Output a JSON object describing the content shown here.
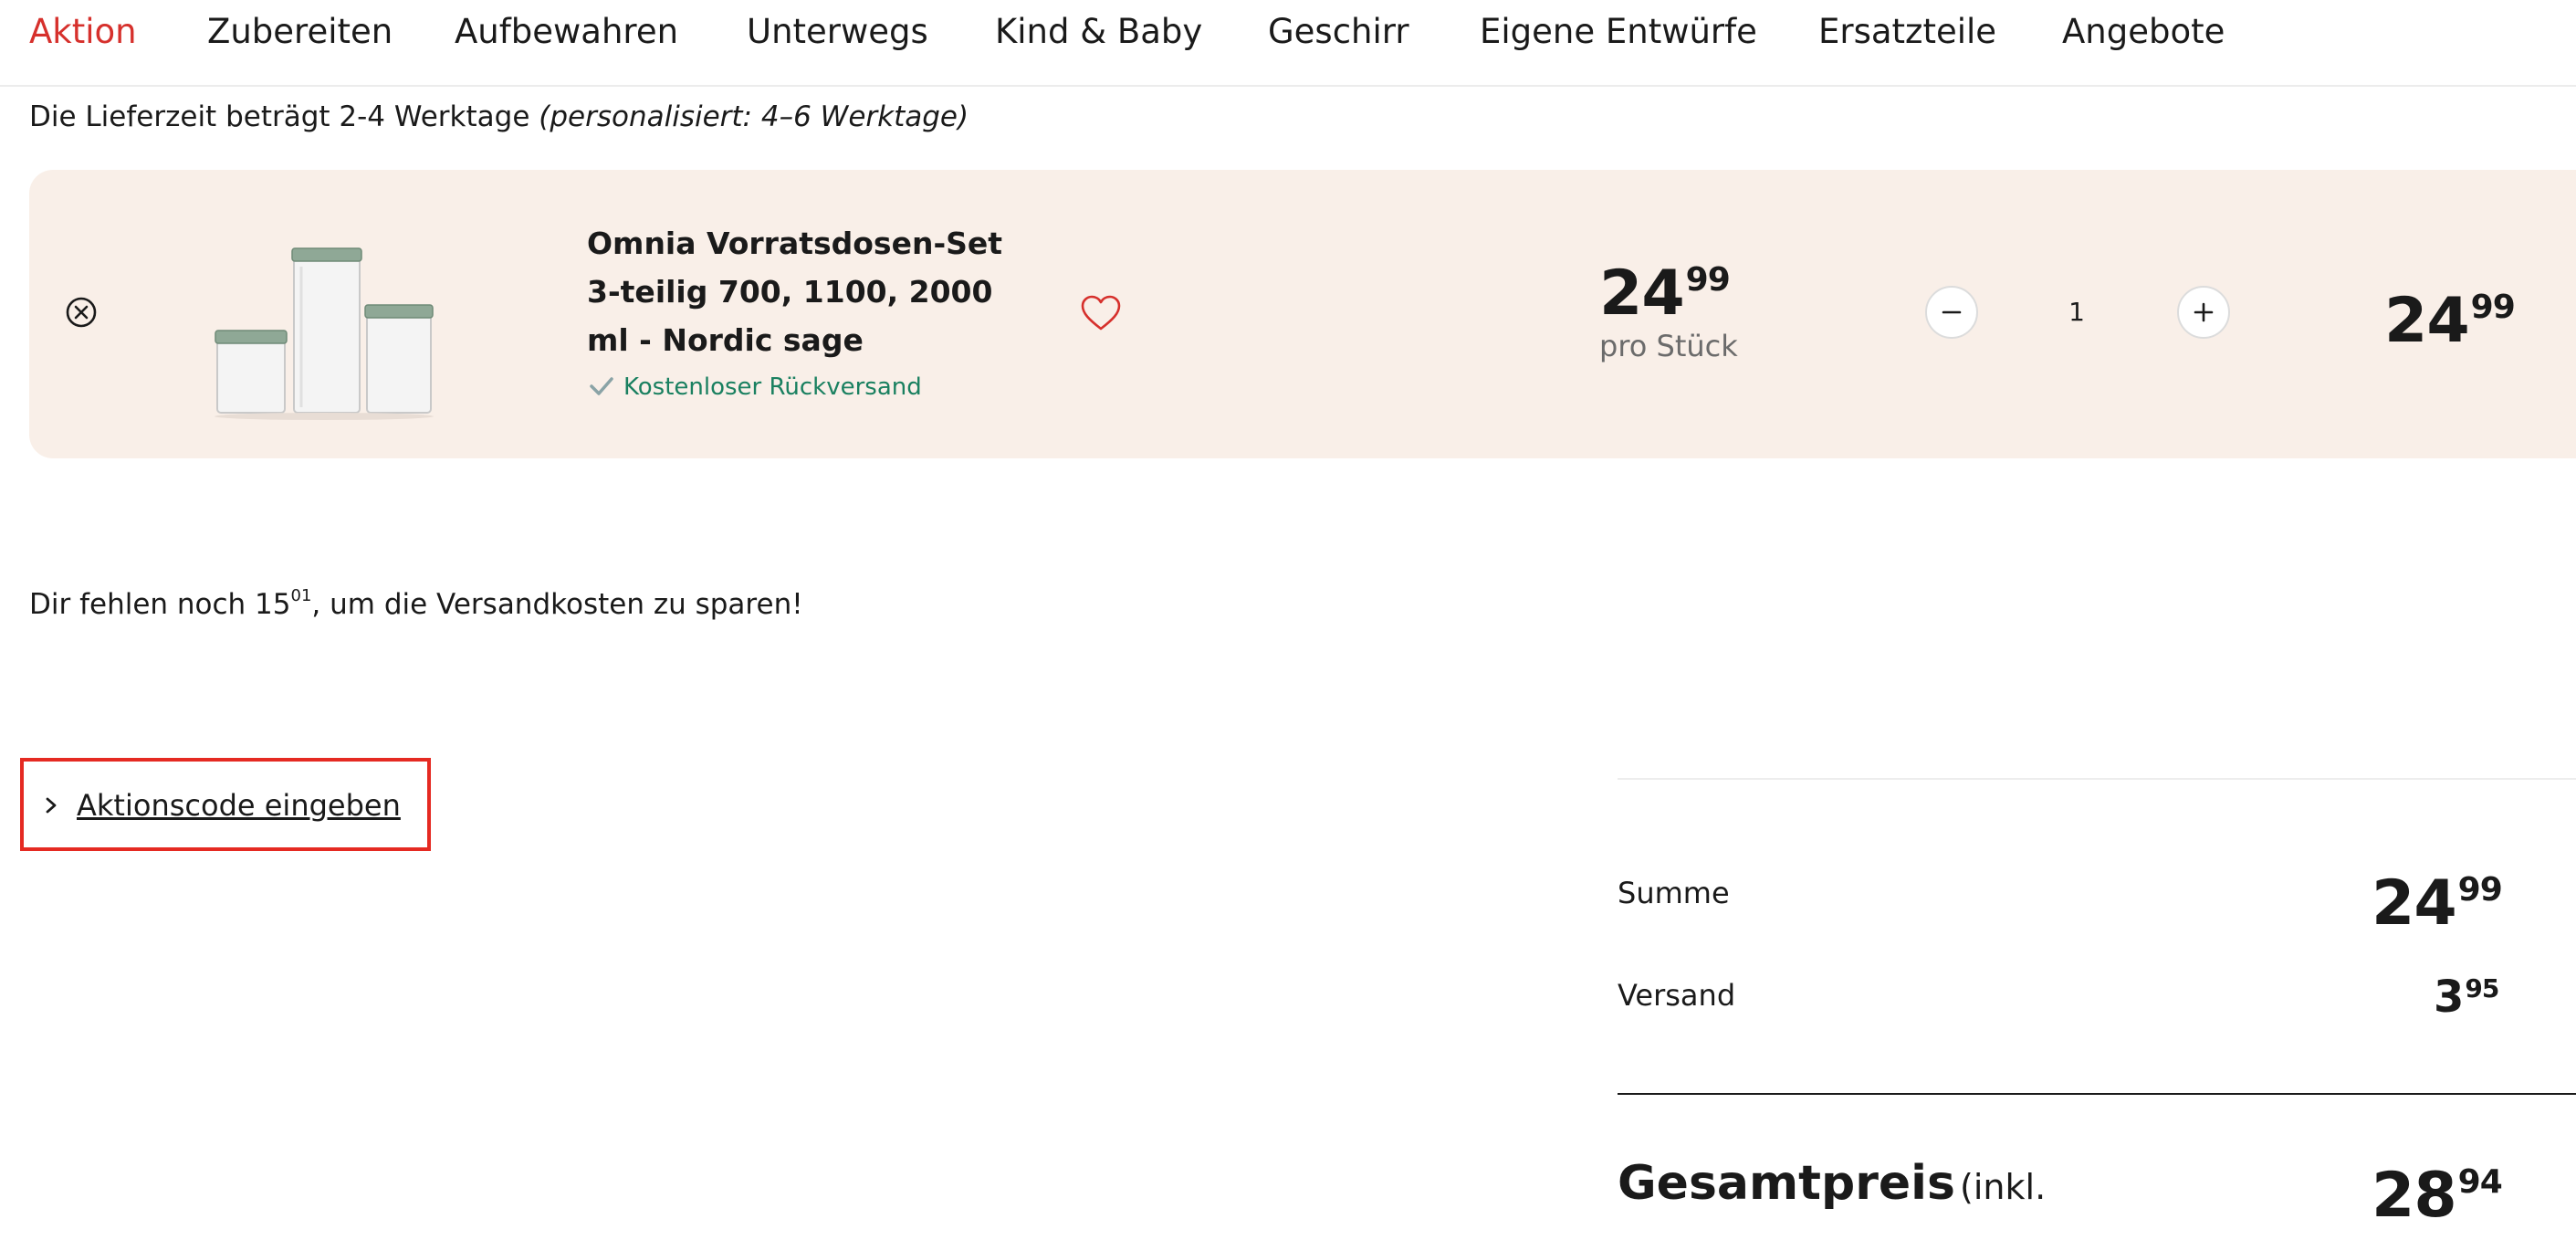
{
  "nav": {
    "items": [
      {
        "label": "Aktion",
        "active": true
      },
      {
        "label": "Zubereiten"
      },
      {
        "label": "Aufbewahren"
      },
      {
        "label": "Unterwegs"
      },
      {
        "label": "Kind & Baby"
      },
      {
        "label": "Geschirr"
      },
      {
        "label": "Eigene Entwürfe"
      },
      {
        "label": "Ersatzteile"
      },
      {
        "label": "Angebote"
      }
    ]
  },
  "delivery": {
    "text": "Die Lieferzeit beträgt 2-4 Werktage",
    "personalized": "(personalisiert: 4–6 Werktage)"
  },
  "cart_item": {
    "title": "Omnia Vorratsdosen-Set 3-teilig 700, 1100, 2000 ml - Nordic sage",
    "return_note": "Kostenloser Rückversand",
    "unit_price_main": "24",
    "unit_price_cents": "99",
    "per_piece": "pro Stück",
    "quantity": "1",
    "line_total_main": "24",
    "line_total_cents": "99"
  },
  "shipping_hint": {
    "before": "Dir fehlen noch 15",
    "cents": "01",
    "after": ", um die Versandkosten zu sparen!"
  },
  "promo": {
    "label": "Aktionscode eingeben"
  },
  "summary": {
    "summe_label": "Summe",
    "summe_main": "24",
    "summe_cents": "99",
    "versand_label": "Versand",
    "versand_main": "3",
    "versand_cents": "95",
    "total_label": "Gesamtpreis",
    "total_sub": "(inkl.",
    "total_main": "28",
    "total_cents": "94"
  },
  "colors": {
    "accent": "#d6302c",
    "card_bg": "#f9efe8",
    "success": "#1a8060",
    "highlight": "#e52a22"
  }
}
